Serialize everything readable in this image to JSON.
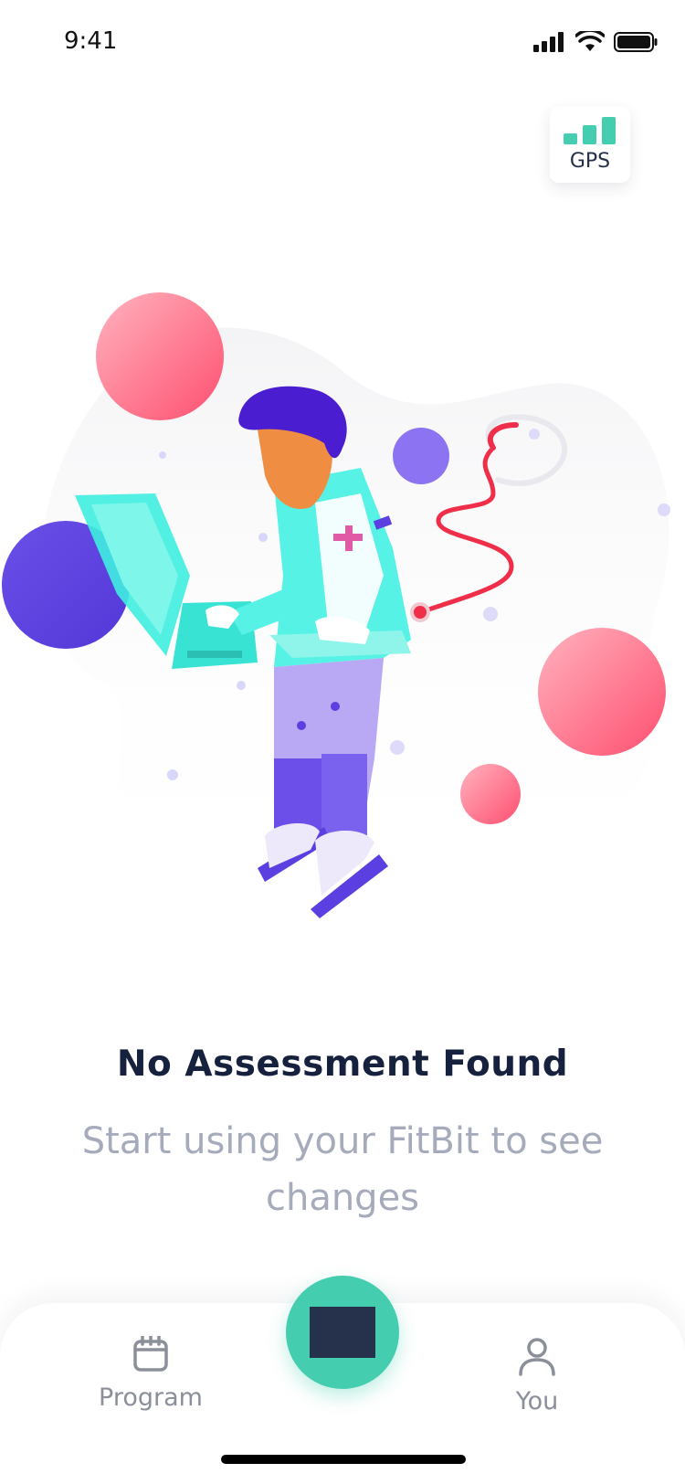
{
  "status_bar": {
    "time": "9:41"
  },
  "gps_chip": {
    "label": "GPS"
  },
  "empty_state": {
    "title": "No Assessment Found",
    "subtitle": "Start using your FitBit to see changes"
  },
  "nav": {
    "program_label": "Program",
    "you_label": "You"
  },
  "colors": {
    "accent": "#44cdae",
    "title": "#15213d",
    "subtitle": "#a5abbb",
    "nav_label": "#8b8f9a"
  }
}
